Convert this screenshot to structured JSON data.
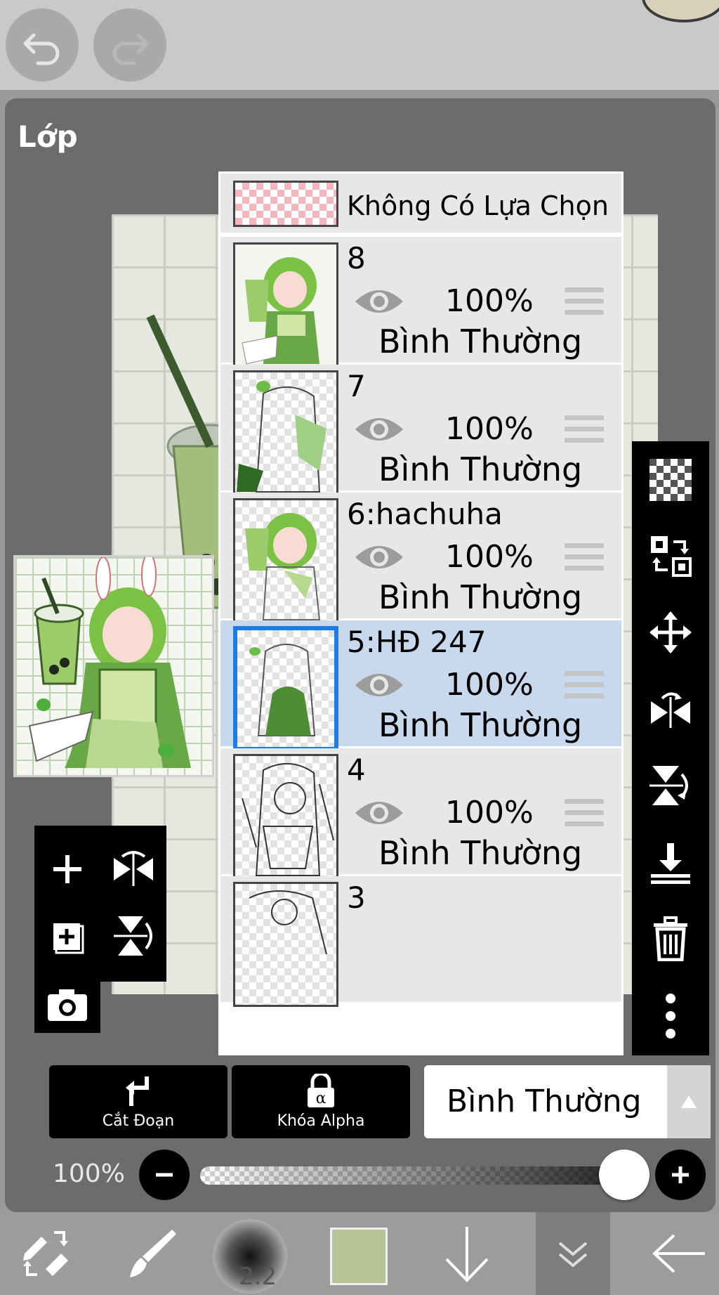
{
  "panel": {
    "title": "Lớp"
  },
  "selection_row": {
    "label": "Không Có Lựa Chọn"
  },
  "layers": [
    {
      "name": "8",
      "opacity": "100%",
      "blend": "Bình Thường",
      "selected": false
    },
    {
      "name": "7",
      "opacity": "100%",
      "blend": "Bình Thường",
      "selected": false
    },
    {
      "name": "6:hachuha",
      "opacity": "100%",
      "blend": "Bình Thường",
      "selected": false
    },
    {
      "name": "5:HĐ 247",
      "opacity": "100%",
      "blend": "Bình Thường",
      "selected": true
    },
    {
      "name": "4",
      "opacity": "100%",
      "blend": "Bình Thường",
      "selected": false
    },
    {
      "name": "3"
    }
  ],
  "controls": {
    "clipping_label": "Cắt Đoạn",
    "alpha_lock_label": "Khóa Alpha",
    "blend_mode": "Bình Thường",
    "opacity_label": "100%",
    "opacity_value": 1.0
  },
  "toolbar": {
    "brush_size": "2.2",
    "color": "#b6c498"
  },
  "colors": {
    "selected_row": "#c8d8ed",
    "selected_border": "#1e7ce8",
    "panel": "#6c6c6c"
  }
}
